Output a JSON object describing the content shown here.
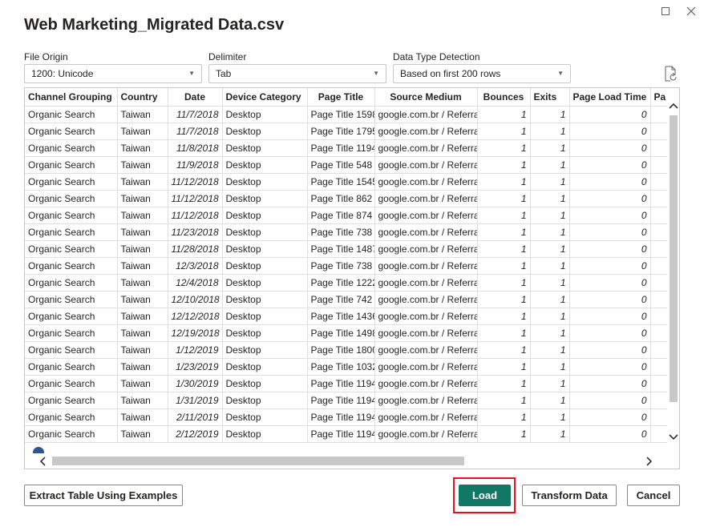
{
  "dialog": {
    "title": "Web Marketing_Migrated Data.csv"
  },
  "options": {
    "file_origin": {
      "label": "File Origin",
      "value": "1200: Unicode"
    },
    "delimiter": {
      "label": "Delimiter",
      "value": "Tab"
    },
    "data_type_detection": {
      "label": "Data Type Detection",
      "value": "Based on first 200 rows"
    }
  },
  "table": {
    "columns": [
      "Channel Grouping",
      "Country",
      "Date",
      "Device Category",
      "Page Title",
      "Source Medium",
      "Bounces",
      "Exits",
      "Page Load Time",
      "Pa"
    ],
    "rows": [
      [
        "Organic Search",
        "Taiwan",
        "11/7/2018",
        "Desktop",
        "Page Title 1598",
        "google.com.br / Referral",
        "1",
        "1",
        "0"
      ],
      [
        "Organic Search",
        "Taiwan",
        "11/7/2018",
        "Desktop",
        "Page Title 1795",
        "google.com.br / Referral",
        "1",
        "1",
        "0"
      ],
      [
        "Organic Search",
        "Taiwan",
        "11/8/2018",
        "Desktop",
        "Page Title 1194",
        "google.com.br / Referral",
        "1",
        "1",
        "0"
      ],
      [
        "Organic Search",
        "Taiwan",
        "11/9/2018",
        "Desktop",
        "Page Title 548",
        "google.com.br / Referral",
        "1",
        "1",
        "0"
      ],
      [
        "Organic Search",
        "Taiwan",
        "11/12/2018",
        "Desktop",
        "Page Title 1545",
        "google.com.br / Referral",
        "1",
        "1",
        "0"
      ],
      [
        "Organic Search",
        "Taiwan",
        "11/12/2018",
        "Desktop",
        "Page Title 862",
        "google.com.br / Referral",
        "1",
        "1",
        "0"
      ],
      [
        "Organic Search",
        "Taiwan",
        "11/12/2018",
        "Desktop",
        "Page Title 874",
        "google.com.br / Referral",
        "1",
        "1",
        "0"
      ],
      [
        "Organic Search",
        "Taiwan",
        "11/23/2018",
        "Desktop",
        "Page Title 738",
        "google.com.br / Referral",
        "1",
        "1",
        "0"
      ],
      [
        "Organic Search",
        "Taiwan",
        "11/28/2018",
        "Desktop",
        "Page Title 1487",
        "google.com.br / Referral",
        "1",
        "1",
        "0"
      ],
      [
        "Organic Search",
        "Taiwan",
        "12/3/2018",
        "Desktop",
        "Page Title 738",
        "google.com.br / Referral",
        "1",
        "1",
        "0"
      ],
      [
        "Organic Search",
        "Taiwan",
        "12/4/2018",
        "Desktop",
        "Page Title 1222",
        "google.com.br / Referral",
        "1",
        "1",
        "0"
      ],
      [
        "Organic Search",
        "Taiwan",
        "12/10/2018",
        "Desktop",
        "Page Title 742",
        "google.com.br / Referral",
        "1",
        "1",
        "0"
      ],
      [
        "Organic Search",
        "Taiwan",
        "12/12/2018",
        "Desktop",
        "Page Title 1436",
        "google.com.br / Referral",
        "1",
        "1",
        "0"
      ],
      [
        "Organic Search",
        "Taiwan",
        "12/19/2018",
        "Desktop",
        "Page Title 1498",
        "google.com.br / Referral",
        "1",
        "1",
        "0"
      ],
      [
        "Organic Search",
        "Taiwan",
        "1/12/2019",
        "Desktop",
        "Page Title 1800",
        "google.com.br / Referral",
        "1",
        "1",
        "0"
      ],
      [
        "Organic Search",
        "Taiwan",
        "1/23/2019",
        "Desktop",
        "Page Title 1032",
        "google.com.br / Referral",
        "1",
        "1",
        "0"
      ],
      [
        "Organic Search",
        "Taiwan",
        "1/30/2019",
        "Desktop",
        "Page Title 1194",
        "google.com.br / Referral",
        "1",
        "1",
        "0"
      ],
      [
        "Organic Search",
        "Taiwan",
        "1/31/2019",
        "Desktop",
        "Page Title 1194",
        "google.com.br / Referral",
        "1",
        "1",
        "0"
      ],
      [
        "Organic Search",
        "Taiwan",
        "2/11/2019",
        "Desktop",
        "Page Title 1194",
        "google.com.br / Referral",
        "1",
        "1",
        "0"
      ],
      [
        "Organic Search",
        "Taiwan",
        "2/12/2019",
        "Desktop",
        "Page Title 1194",
        "google.com.br / Referral",
        "1",
        "1",
        "0"
      ]
    ]
  },
  "buttons": {
    "extract": "Extract Table Using Examples",
    "load": "Load",
    "transform": "Transform Data",
    "cancel": "Cancel"
  },
  "colors": {
    "load_button": "#117865",
    "highlight": "#e81123"
  },
  "icons": [
    "maximize-icon",
    "close-icon",
    "refresh-icon",
    "chevron-down-icon",
    "help-icon"
  ]
}
